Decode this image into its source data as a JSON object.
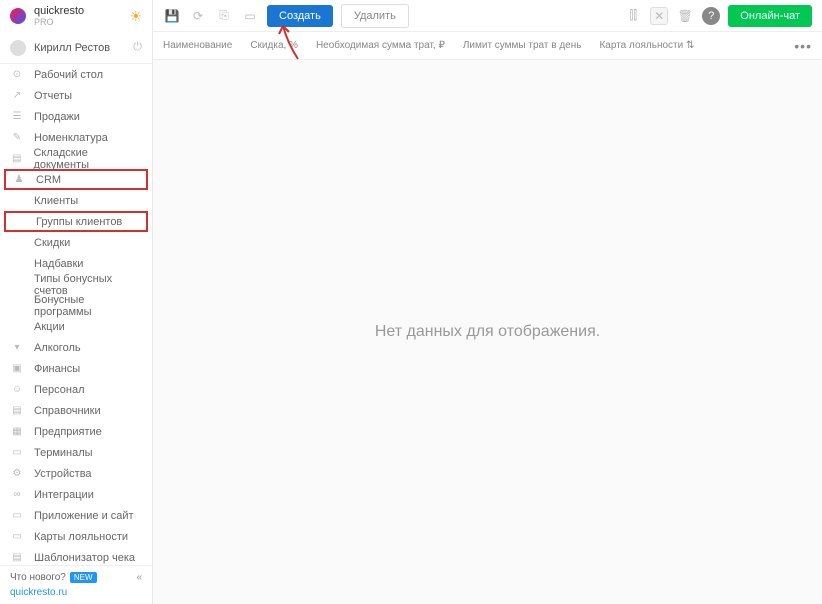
{
  "brand": {
    "name": "quickresto",
    "sub": "PRO"
  },
  "user": {
    "name": "Кирилл Рестов"
  },
  "nav": {
    "items": [
      {
        "label": "Рабочий стол",
        "icon": "⊙"
      },
      {
        "label": "Отчеты",
        "icon": "↗"
      },
      {
        "label": "Продажи",
        "icon": "☰"
      },
      {
        "label": "Номенклатура",
        "icon": "✎"
      },
      {
        "label": "Складские документы",
        "icon": "▤"
      },
      {
        "label": "CRM",
        "icon": "♟",
        "hl": true
      },
      {
        "label": "Клиенты",
        "sub": true
      },
      {
        "label": "Группы клиентов",
        "sub": true,
        "hl": true
      },
      {
        "label": "Скидки",
        "sub": true
      },
      {
        "label": "Надбавки",
        "sub": true
      },
      {
        "label": "Типы бонусных счетов",
        "sub": true
      },
      {
        "label": "Бонусные программы",
        "sub": true
      },
      {
        "label": "Акции",
        "sub": true
      },
      {
        "label": "Алкоголь",
        "icon": "▾"
      },
      {
        "label": "Финансы",
        "icon": "▣"
      },
      {
        "label": "Персонал",
        "icon": "☺"
      },
      {
        "label": "Справочники",
        "icon": "▤"
      },
      {
        "label": "Предприятие",
        "icon": "▦"
      },
      {
        "label": "Терминалы",
        "icon": "▭"
      },
      {
        "label": "Устройства",
        "icon": "⚙"
      },
      {
        "label": "Интеграции",
        "icon": "∞"
      },
      {
        "label": "Приложение и сайт",
        "icon": "▭"
      },
      {
        "label": "Карты лояльности",
        "icon": "▭"
      },
      {
        "label": "Шаблонизатор чека",
        "icon": "▤"
      }
    ]
  },
  "footer": {
    "whatsnew": "Что нового?",
    "new": "NEW",
    "link": "quickresto.ru"
  },
  "toolbar": {
    "create": "Создать",
    "delete": "Удалить",
    "chat": "Онлайн-чат"
  },
  "columns": [
    "Наименование",
    "Скидка, %",
    "Необходимая сумма трат, ₽",
    "Лимит суммы трат в день",
    "Карта лояльности ⇅"
  ],
  "empty": "Нет данных для отображения."
}
